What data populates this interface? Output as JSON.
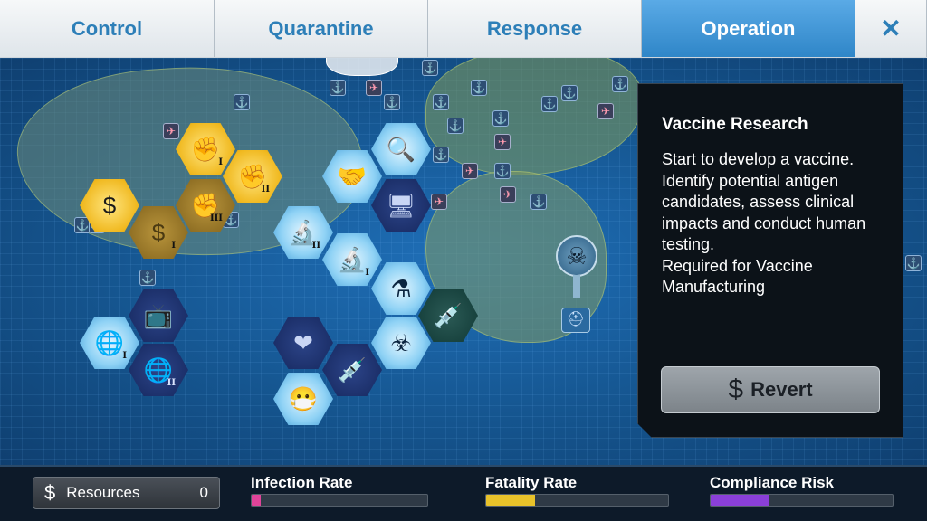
{
  "tabs": [
    {
      "label": "Control",
      "active": false
    },
    {
      "label": "Quarantine",
      "active": false
    },
    {
      "label": "Response",
      "active": false
    },
    {
      "label": "Operation",
      "active": true
    }
  ],
  "close_label": "✕",
  "upgrades": [
    {
      "name": "protest-fist-1-hex",
      "icon": "fist-icon",
      "glyph": "✊",
      "level": "I",
      "style": "gold"
    },
    {
      "name": "protest-fist-2-hex",
      "icon": "fist-icon",
      "glyph": "✊",
      "level": "II",
      "style": "gold"
    },
    {
      "name": "protest-fist-3-hex",
      "icon": "fist-icon",
      "glyph": "✊",
      "level": "III",
      "style": "golddim"
    },
    {
      "name": "funding-1-hex",
      "icon": "money-hand-icon",
      "glyph": "$",
      "level": "",
      "style": "gold"
    },
    {
      "name": "funding-2-hex",
      "icon": "money-hand-icon",
      "glyph": "$",
      "level": "I",
      "style": "golddim"
    },
    {
      "name": "investigate-hex",
      "icon": "magnifier-icon",
      "glyph": "🔍",
      "level": "",
      "style": "blue"
    },
    {
      "name": "cooperation-hex",
      "icon": "handshake-icon",
      "glyph": "🤝",
      "level": "",
      "style": "blue"
    },
    {
      "name": "computer-hex",
      "icon": "computer-icon",
      "glyph": "🖥",
      "level": "",
      "style": "navy"
    },
    {
      "name": "microscope-2-hex",
      "icon": "microscope-icon",
      "glyph": "🔬",
      "level": "II",
      "style": "blue"
    },
    {
      "name": "microscope-1-hex",
      "icon": "microscope-icon",
      "glyph": "🔬",
      "level": "I",
      "style": "blue"
    },
    {
      "name": "vaccine-research-hex",
      "icon": "flask-gear-icon",
      "glyph": "⚗",
      "level": "",
      "style": "blue"
    },
    {
      "name": "vaccine-manufacture-hex",
      "icon": "heart-syringe-icon",
      "glyph": "💉",
      "level": "",
      "style": "teal"
    },
    {
      "name": "broadcast-off-hex",
      "icon": "tv-crossed-icon",
      "glyph": "📺",
      "level": "",
      "style": "navy"
    },
    {
      "name": "global-1-hex",
      "icon": "globe-laurel-icon",
      "glyph": "🌐",
      "level": "I",
      "style": "blue"
    },
    {
      "name": "global-2-hex",
      "icon": "globe-laurel-icon",
      "glyph": "🌐",
      "level": "II",
      "style": "navy"
    },
    {
      "name": "heart-organ-hex",
      "icon": "heart-organ-icon",
      "glyph": "❤",
      "level": "",
      "style": "navy"
    },
    {
      "name": "syringe-hex",
      "icon": "syringe-icon",
      "glyph": "💉",
      "level": "",
      "style": "navy"
    },
    {
      "name": "gas-mask-hex",
      "icon": "gas-mask-icon",
      "glyph": "😷",
      "level": "",
      "style": "blue"
    },
    {
      "name": "biohazard-hex",
      "icon": "biohazard-icon",
      "glyph": "☣",
      "level": "",
      "style": "blue"
    }
  ],
  "info": {
    "title": "Vaccine Research",
    "description": "Start to develop a vaccine.\nIdentify potential antigen candidates, assess clinical impacts and conduct human testing.\nRequired for Vaccine Manufacturing",
    "button_icon": "$",
    "button_label": "Revert"
  },
  "bottom": {
    "resources_icon": "$",
    "resources_label": "Resources",
    "resources_value": "0",
    "infection_label": "Infection Rate",
    "infection_fraction": 0.05,
    "infection_color": "#e0449a",
    "fatality_label": "Fatality Rate",
    "fatality_fraction": 0.27,
    "fatality_color": "#e8c22a",
    "compliance_label": "Compliance Risk",
    "compliance_fraction": 0.32,
    "compliance_color": "#8a3fd8"
  },
  "markers": {
    "skull_icon": "skull-icon",
    "skull_glyph": "☠",
    "mask_icon": "gas-mask-icon",
    "mask_glyph": "⛑",
    "anchor_glyph": "⚓",
    "plane_glyph": "✈"
  }
}
